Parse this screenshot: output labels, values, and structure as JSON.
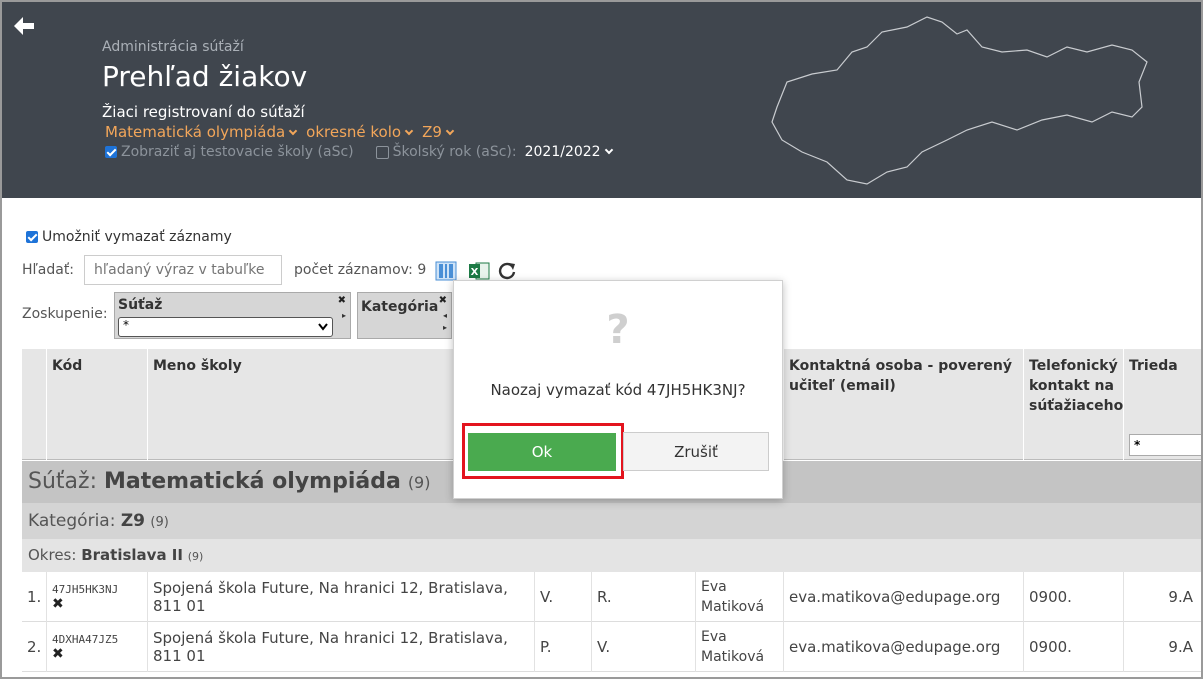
{
  "header": {
    "back_icon": "arrow-left-icon",
    "subtitle": "Administrácia súťaží",
    "title": "Prehľad žiakov",
    "description": "Žiaci registrovaní do súťaží",
    "filters": {
      "competition": "Matematická olympiáda",
      "round": "okresné kolo",
      "category": "Z9"
    },
    "show_test_schools_label": "Zobraziť aj testovacie školy (aSc)",
    "school_year_label": "Školský rok (aSc):",
    "school_year_value": "2021/2022",
    "map_icon": "slovakia-map-outline"
  },
  "toolbar": {
    "allow_delete_label": "Umožniť vymazať záznamy",
    "search_label": "Hľadať:",
    "search_placeholder": "hľadaný výraz v tabuľke",
    "count_label": "počet záznamov: 9",
    "icons": [
      "columns-icon",
      "excel-icon",
      "refresh-icon"
    ]
  },
  "grouping": {
    "label": "Zoskupenie:",
    "groups": [
      {
        "name": "Súťaž",
        "value": "*"
      },
      {
        "name": "Kategória"
      }
    ]
  },
  "table": {
    "headers": {
      "code": "Kód",
      "school": "Meno školy",
      "contact": "Kontaktná osoba - poverený učiteľ (email)",
      "phone": "Telefonický kontakt na súťažiaceho",
      "class": "Trieda",
      "class_filter": "*"
    },
    "group1": {
      "label": "Súťaž:",
      "value": "Matematická olympiáda",
      "count": "(9)"
    },
    "group2": {
      "label": "Kategória:",
      "value": "Z9",
      "count": "(9)"
    },
    "group3": {
      "label": "Okres:",
      "value": "Bratislava II",
      "count": "(9)"
    },
    "rows": [
      {
        "num": "1.",
        "code": "47JH5HK3NJ",
        "school": "Spojená škola Future, Na hranici 12, Bratislava, 811 01",
        "first": "V.",
        "last": "R.",
        "teacher1": "Eva",
        "teacher2": "Matiková",
        "email": "eva.matikova@edupage.org",
        "phone": "0900.",
        "class": "9.A"
      },
      {
        "num": "2.",
        "code": "4DXHA47JZ5",
        "school": "Spojená škola Future, Na hranici 12, Bratislava, 811 01",
        "first": "P.",
        "last": "V.",
        "teacher1": "Eva",
        "teacher2": "Matiková",
        "email": "eva.matikova@edupage.org",
        "phone": "0900.",
        "class": "9.A"
      }
    ]
  },
  "dialog": {
    "icon": "question-mark-icon",
    "message": "Naozaj vymazať kód 47JH5HK3NJ?",
    "ok_label": "Ok",
    "cancel_label": "Zrušiť",
    "ok_color": "#4aaa4f",
    "highlight_color": "#e3141e"
  }
}
